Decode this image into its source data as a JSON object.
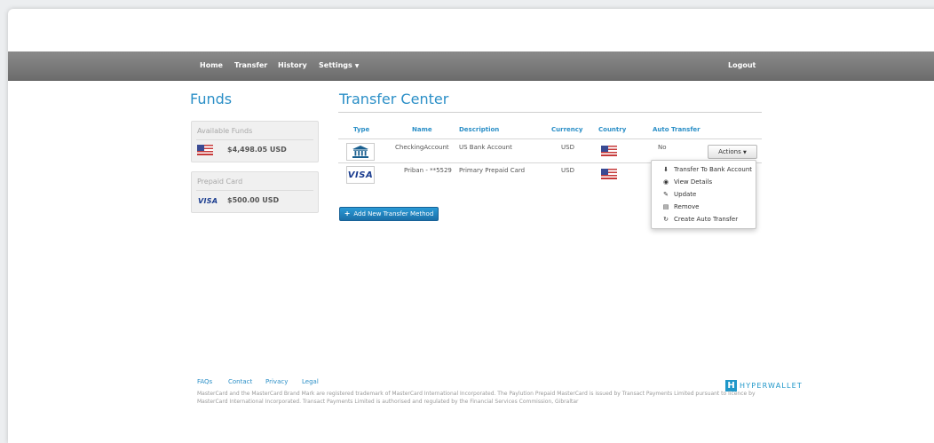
{
  "nav": {
    "home": "Home",
    "transfer": "Transfer",
    "history": "History",
    "settings": "Settings",
    "logout": "Logout"
  },
  "funds": {
    "title": "Funds",
    "available_label": "Available Funds",
    "available_amount": "$4,498.05 USD",
    "prepaid_label": "Prepaid Card",
    "prepaid_amount": "$500.00 USD",
    "prepaid_brand": "VISA"
  },
  "transfer": {
    "title": "Transfer Center",
    "columns": [
      "Type",
      "Name",
      "Description",
      "Currency",
      "Country",
      "Auto Transfer"
    ],
    "rows": [
      {
        "type_icon": "bank-icon",
        "name": "CheckingAccount",
        "description": "US Bank Account",
        "currency": "USD",
        "country_icon": "us-flag-icon",
        "auto_transfer": "No"
      },
      {
        "type_icon": "visa-icon",
        "type_label": "VISA",
        "name": "Priban - **5529",
        "description": "Primary Prepaid Card",
        "currency": "USD",
        "country_icon": "us-flag-icon",
        "auto_transfer": ""
      }
    ],
    "actions_label": "Actions",
    "add_button_label": "Add New Transfer Method"
  },
  "dropdown": {
    "items": [
      {
        "icon": "download-icon",
        "label": "Transfer To Bank Account"
      },
      {
        "icon": "eye-icon",
        "label": "View Details"
      },
      {
        "icon": "edit-icon",
        "label": "Update"
      },
      {
        "icon": "trash-icon",
        "label": "Remove"
      },
      {
        "icon": "refresh-icon",
        "label": "Create Auto Transfer"
      }
    ]
  },
  "footer": {
    "links": [
      "FAQs",
      "Contact",
      "Privacy",
      "Legal"
    ],
    "disclaimer": "MasterCard and the MasterCard Brand Mark are registered trademark of MasterCard International Incorporated. The Paylution Prepaid MasterCard is issued by Transact Payments Limited pursuant to licence by MasterCard International Incorporated. Transact Payments Limited is authorised and regulated by the Financial Services Commission, Gibraltar",
    "logo_mark": "H",
    "logo_text": "HYPERWALLET"
  },
  "colors": {
    "accent": "#2b8fc7",
    "nav_bg": "#7a7a7a",
    "button_primary": "#1b7fc0"
  }
}
